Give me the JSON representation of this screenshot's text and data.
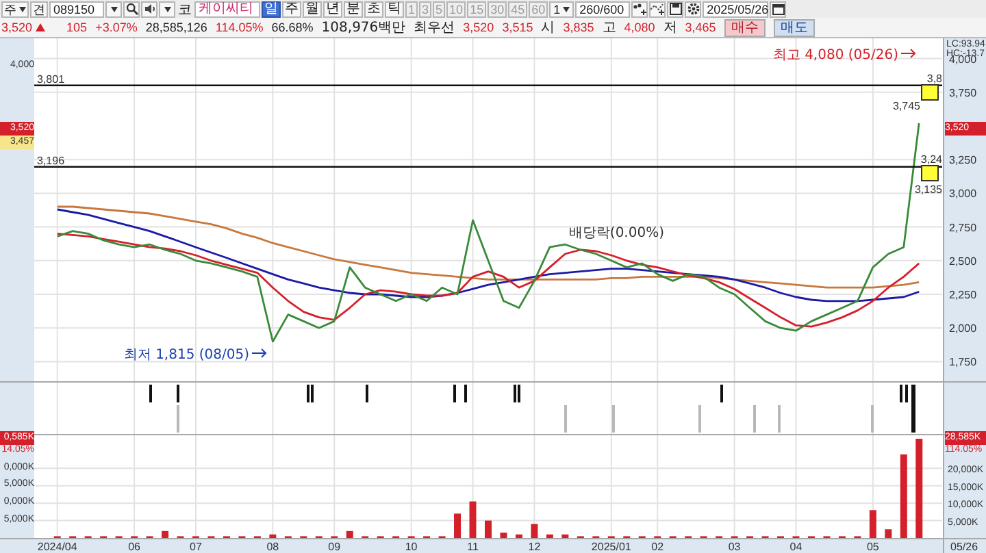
{
  "toolbar": {
    "market": "주",
    "code_type": "견",
    "code": "089150",
    "market_tag": "코",
    "name": "케이씨티",
    "periods": [
      {
        "label": "일",
        "selected": true
      },
      {
        "label": "주",
        "selected": false
      },
      {
        "label": "월",
        "selected": false
      },
      {
        "label": "년",
        "selected": false
      },
      {
        "label": "분",
        "selected": false
      },
      {
        "label": "초",
        "selected": false
      },
      {
        "label": "틱",
        "selected": false
      }
    ],
    "intervals": [
      {
        "label": "1",
        "disabled": true
      },
      {
        "label": "3",
        "disabled": true
      },
      {
        "label": "5",
        "disabled": true
      },
      {
        "label": "10",
        "disabled": true
      },
      {
        "label": "15",
        "disabled": true
      },
      {
        "label": "30",
        "disabled": true
      },
      {
        "label": "45",
        "disabled": true
      },
      {
        "label": "60",
        "disabled": true
      }
    ],
    "unit": "1",
    "count": "260/600",
    "date": "2025/05/26"
  },
  "quote": {
    "price": "3,520",
    "up": true,
    "change": "105",
    "change_rate": "+3.07%",
    "volume": "28,585,126",
    "volume_rate": "114.05%",
    "turnover": "66.68%",
    "amount": "108,976백만",
    "best_label": "최우선",
    "ask": "3,520",
    "bid": "3,515",
    "open_label": "시",
    "open": "3,835",
    "high_label": "고",
    "high": "4,080",
    "low_label": "저",
    "low": "3,465",
    "buy": "매수",
    "sell": "매도"
  },
  "price_panel": {
    "indicator_labels": [
      "LC:93.94",
      "HC:-13.7"
    ],
    "left_tags": [
      {
        "label": "4,000",
        "kind": "tick"
      },
      {
        "label": "3,520",
        "kind": "current"
      },
      {
        "label": "3,457",
        "kind": "previous"
      }
    ],
    "right_tags": [
      {
        "label": "3,520",
        "kind": "current"
      }
    ],
    "chart_data": {
      "type": "line",
      "ylim": [
        1600,
        4150
      ],
      "yticks": [
        {
          "value": 1750,
          "label": "1,750"
        },
        {
          "value": 2000,
          "label": "2,000"
        },
        {
          "value": 2250,
          "label": "2,250"
        },
        {
          "value": 2500,
          "label": "2,500"
        },
        {
          "value": 2750,
          "label": "2,750"
        },
        {
          "value": 3000,
          "label": "3,000"
        },
        {
          "value": 3250,
          "label": "3,250"
        },
        {
          "value": 3750,
          "label": "3,750"
        },
        {
          "value": 4000,
          "label": "4,000"
        }
      ],
      "series": [
        {
          "color": "#c8783c",
          "values": [
            2900,
            2900,
            2890,
            2880,
            2870,
            2860,
            2850,
            2830,
            2810,
            2790,
            2770,
            2740,
            2700,
            2670,
            2630,
            2600,
            2570,
            2540,
            2510,
            2490,
            2470,
            2450,
            2430,
            2410,
            2400,
            2390,
            2380,
            2370,
            2360,
            2360,
            2360,
            2360,
            2360,
            2360,
            2360,
            2360,
            2370,
            2370,
            2380,
            2380,
            2380,
            2380,
            2380,
            2370,
            2360,
            2350,
            2340,
            2330,
            2320,
            2310,
            2300,
            2300,
            2300,
            2300,
            2310,
            2320,
            2340
          ]
        },
        {
          "color": "#1a1aa6",
          "values": [
            2880,
            2860,
            2840,
            2810,
            2780,
            2750,
            2720,
            2680,
            2640,
            2600,
            2560,
            2520,
            2480,
            2440,
            2400,
            2360,
            2330,
            2300,
            2280,
            2260,
            2250,
            2250,
            2240,
            2230,
            2230,
            2240,
            2260,
            2290,
            2320,
            2340,
            2360,
            2380,
            2400,
            2410,
            2420,
            2430,
            2440,
            2440,
            2430,
            2420,
            2410,
            2400,
            2390,
            2380,
            2360,
            2330,
            2300,
            2260,
            2230,
            2210,
            2200,
            2200,
            2200,
            2210,
            2220,
            2230,
            2270
          ]
        },
        {
          "color": "#d4202a",
          "values": [
            2700,
            2690,
            2680,
            2660,
            2640,
            2620,
            2600,
            2590,
            2570,
            2540,
            2500,
            2470,
            2440,
            2410,
            2300,
            2200,
            2120,
            2080,
            2060,
            2150,
            2250,
            2280,
            2270,
            2250,
            2240,
            2240,
            2260,
            2380,
            2420,
            2380,
            2300,
            2350,
            2450,
            2550,
            2580,
            2570,
            2540,
            2500,
            2470,
            2450,
            2420,
            2390,
            2370,
            2340,
            2290,
            2220,
            2150,
            2080,
            2020,
            2010,
            2040,
            2080,
            2130,
            2200,
            2300,
            2380,
            2480
          ]
        },
        {
          "color": "#3a8a3a",
          "values": [
            2680,
            2720,
            2700,
            2650,
            2620,
            2600,
            2620,
            2580,
            2550,
            2500,
            2480,
            2450,
            2420,
            2380,
            1900,
            2100,
            2050,
            2000,
            2050,
            2450,
            2300,
            2250,
            2200,
            2250,
            2200,
            2300,
            2250,
            2800,
            2500,
            2200,
            2150,
            2350,
            2600,
            2620,
            2580,
            2550,
            2500,
            2450,
            2480,
            2400,
            2350,
            2400,
            2380,
            2300,
            2250,
            2150,
            2050,
            2000,
            1980,
            2050,
            2100,
            2150,
            2200,
            2450,
            2550,
            2600,
            3520
          ]
        }
      ],
      "ref_lines": [
        {
          "axis": "y",
          "value": 3801,
          "label": "3,801"
        },
        {
          "axis": "y",
          "value": 3196,
          "label": "3,196"
        }
      ],
      "annotations": [
        "최고 4,080 (05/26)",
        "3,8",
        "3,745",
        "3,24",
        "3,135",
        "배당락(0.00%)",
        "최저 1,815 (08/05)"
      ]
    }
  },
  "volume_panel": {
    "left_tags": [
      {
        "label": "0,585K",
        "kind": "current"
      },
      {
        "label": "14.05%",
        "kind": "rate"
      },
      {
        "label": "0,000K",
        "kind": "tick"
      },
      {
        "label": "5,000K",
        "kind": "tick"
      },
      {
        "label": "0,000K",
        "kind": "tick"
      },
      {
        "label": "5,000K",
        "kind": "tick"
      }
    ],
    "right_tags": [
      {
        "label": "28,585K",
        "kind": "current"
      },
      {
        "label": "114.05%",
        "kind": "rate"
      }
    ],
    "chart_data": {
      "type": "bar",
      "ylim": [
        0,
        29500
      ],
      "categories": [
        "2024/04",
        null,
        null,
        null,
        null,
        "06",
        null,
        null,
        null,
        "07",
        null,
        null,
        null,
        null,
        "08",
        null,
        null,
        null,
        "09",
        null,
        null,
        null,
        null,
        "10",
        null,
        null,
        null,
        "11",
        null,
        null,
        null,
        "12",
        null,
        null,
        null,
        null,
        "2025/01",
        null,
        null,
        "02",
        null,
        null,
        null,
        null,
        "03",
        null,
        null,
        null,
        "04",
        null,
        null,
        null,
        null,
        "05",
        null,
        null,
        null
      ],
      "yticks": [
        {
          "value": 5000,
          "label": "5,000K"
        },
        {
          "value": 10000,
          "label": "10,000K"
        },
        {
          "value": 15000,
          "label": "15,000K"
        },
        {
          "value": 20000,
          "label": "20,000K"
        }
      ],
      "series": [
        {
          "color": "#d4202a",
          "values": [
            500,
            500,
            500,
            500,
            500,
            500,
            500,
            2000,
            500,
            500,
            500,
            500,
            500,
            500,
            1000,
            500,
            500,
            500,
            500,
            2000,
            500,
            500,
            500,
            500,
            500,
            500,
            7000,
            10500,
            5000,
            1500,
            1000,
            4000,
            1000,
            1000,
            500,
            500,
            500,
            500,
            500,
            500,
            500,
            500,
            500,
            500,
            500,
            500,
            500,
            500,
            500,
            500,
            500,
            500,
            500,
            8000,
            2500,
            24000,
            28500
          ]
        }
      ]
    },
    "date_label": "05/26"
  }
}
